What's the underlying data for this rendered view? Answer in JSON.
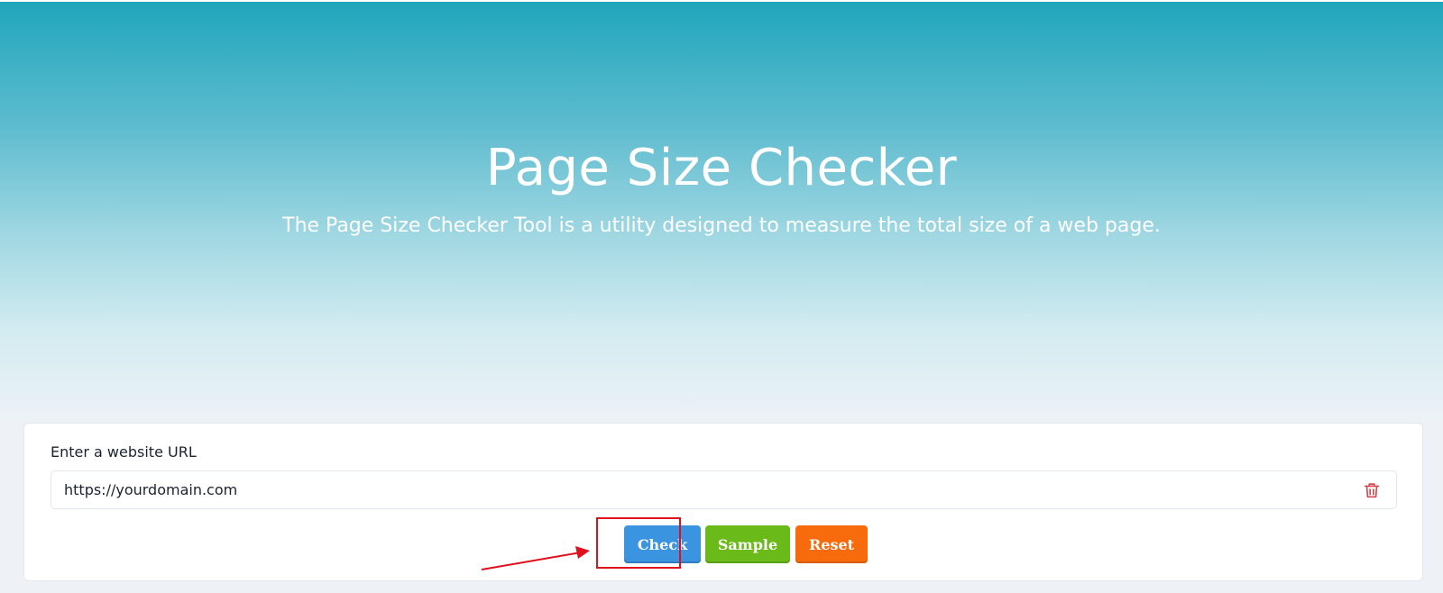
{
  "hero": {
    "title": "Page Size Checker",
    "subtitle": "The Page Size Checker Tool is a utility designed to measure the total size of a web page."
  },
  "form": {
    "label": "Enter a website URL",
    "url_value": "https://yourdomain.com",
    "clear_icon": "trash-icon"
  },
  "buttons": {
    "check": "Check",
    "sample": "Sample",
    "reset": "Reset"
  },
  "colors": {
    "hero_top": "#20a6bc",
    "check": "#3b94e0",
    "sample": "#6aba1a",
    "reset": "#f76b0c",
    "annotation": "#e0101c"
  }
}
